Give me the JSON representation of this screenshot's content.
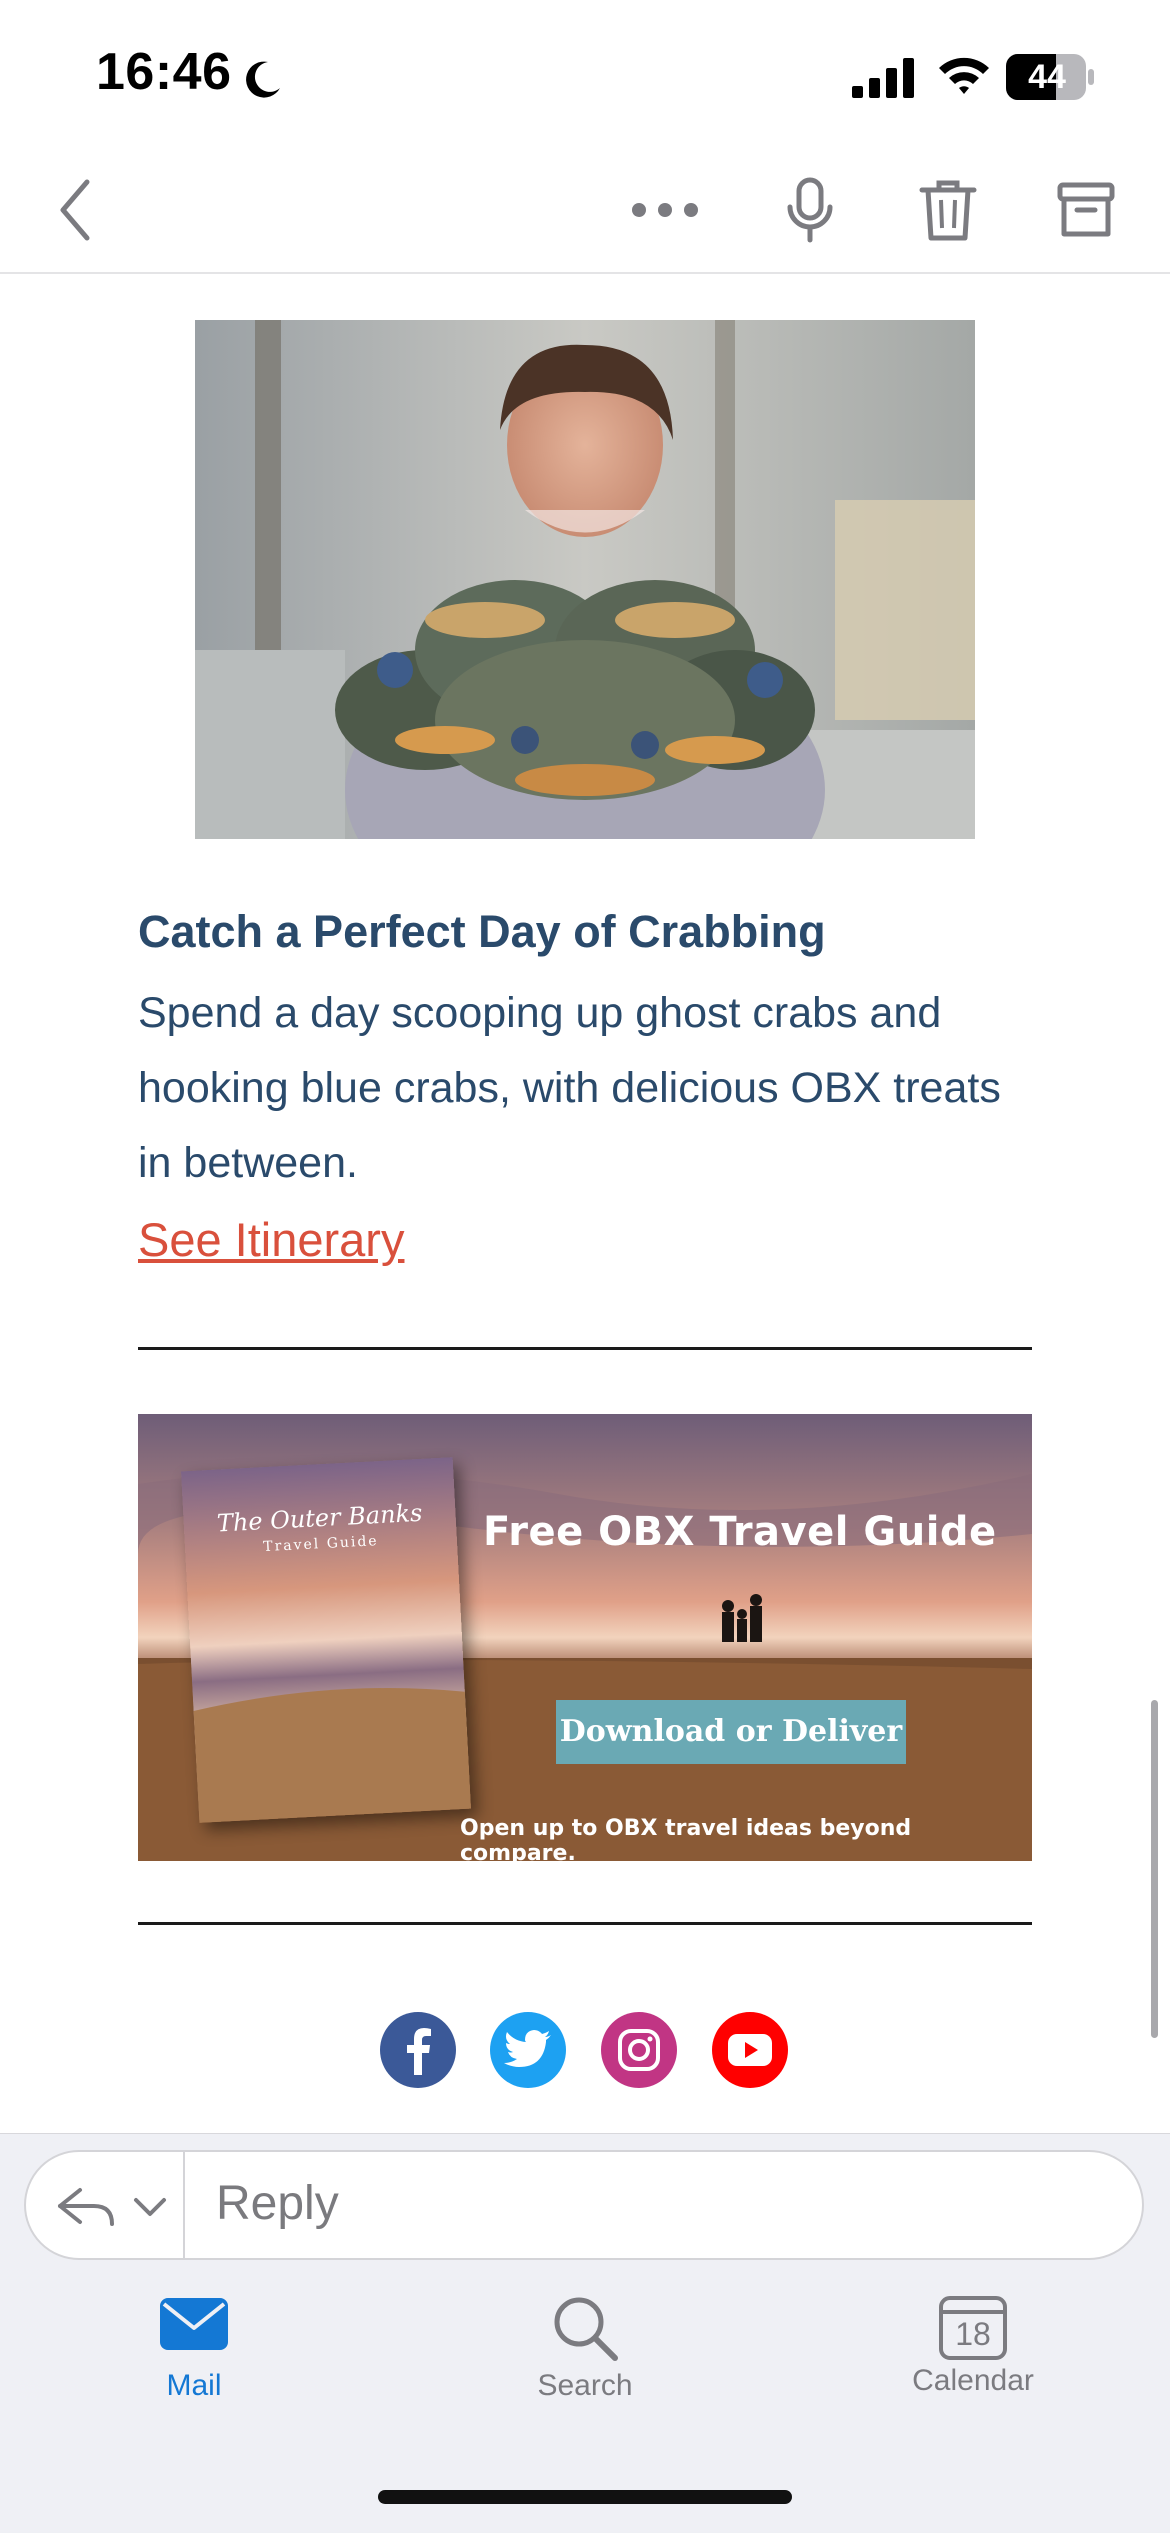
{
  "status_bar": {
    "time": "16:46",
    "battery_level": "44"
  },
  "toolbar": {
    "back_icon": "chevron-left-icon",
    "more_icon": "ellipsis-icon",
    "mic_icon": "microphone-icon",
    "trash_icon": "trash-icon",
    "archive_icon": "archive-box-icon"
  },
  "email": {
    "article": {
      "title": "Catch a Perfect Day of Crabbing",
      "description": "Spend a day scooping up ghost crabs and hooking blue crabs, with delicious OBX treats in between.",
      "link_label": "See Itinerary"
    },
    "guide_banner": {
      "headline": "Free OBX Travel Guide",
      "cta_label": "Download or Deliver",
      "tagline": "Open up to OBX travel ideas beyond compare.",
      "book_title": "The Outer Banks",
      "book_subtitle": "Travel Guide"
    },
    "social": [
      {
        "name": "facebook-icon",
        "color": "#3b5998"
      },
      {
        "name": "twitter-icon",
        "color": "#1da1f2"
      },
      {
        "name": "instagram-icon",
        "color": "#c13584"
      },
      {
        "name": "youtube-icon",
        "color": "#ff0000"
      }
    ]
  },
  "reply_bar": {
    "placeholder": "Reply"
  },
  "tab_bar": {
    "tabs": [
      {
        "label": "Mail",
        "icon": "envelope-icon",
        "active": true
      },
      {
        "label": "Search",
        "icon": "magnifier-icon",
        "active": false
      },
      {
        "label": "Calendar",
        "icon": "calendar-icon",
        "active": false,
        "badge_text": "18"
      }
    ]
  },
  "colors": {
    "accent": "#1478d4",
    "title_text": "#2a4a6b",
    "link": "#d9503c"
  }
}
